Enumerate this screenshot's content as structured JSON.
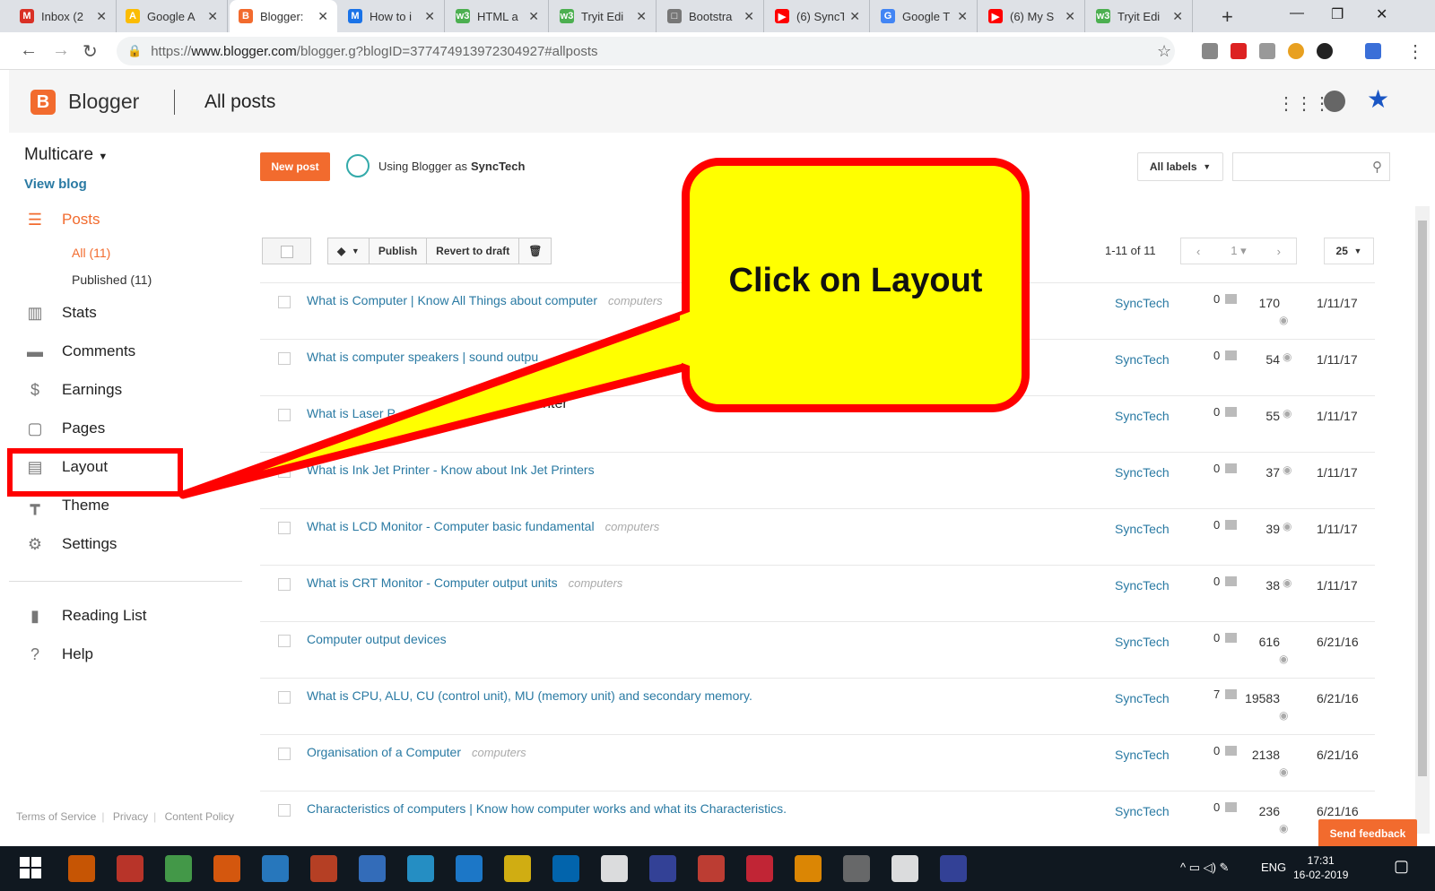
{
  "browser": {
    "tabs": [
      {
        "label": "Inbox (2",
        "icon": "gmail-icon",
        "color": "#d93025",
        "glyph": "M"
      },
      {
        "label": "Google A",
        "icon": "google-ads-icon",
        "color": "#fbbc04",
        "glyph": "A"
      },
      {
        "label": "Blogger:",
        "icon": "blogger-icon",
        "color": "#f26b2e",
        "glyph": "B"
      },
      {
        "label": "How to i",
        "icon": "site-icon",
        "color": "#1a73e8",
        "glyph": "M"
      },
      {
        "label": "HTML a",
        "icon": "w3schools-icon",
        "color": "#4caf50",
        "glyph": "w3"
      },
      {
        "label": "Tryit Edi",
        "icon": "w3schools-icon",
        "color": "#4caf50",
        "glyph": "w3"
      },
      {
        "label": "Bootstra",
        "icon": "document-icon",
        "color": "#777777",
        "glyph": "□"
      },
      {
        "label": "(6) SyncT",
        "icon": "youtube-icon",
        "color": "#ff0000",
        "glyph": "▶"
      },
      {
        "label": "Google T",
        "icon": "google-translate-icon",
        "color": "#4285f4",
        "glyph": "G"
      },
      {
        "label": "(6) My S",
        "icon": "youtube-icon",
        "color": "#ff0000",
        "glyph": "▶"
      },
      {
        "label": "Tryit Edi",
        "icon": "w3schools-icon",
        "color": "#4caf50",
        "glyph": "w3"
      }
    ],
    "url_scheme": "https://",
    "url_host": "www.blogger.com",
    "url_path": "/blogger.g?blogID=3774749139723049​27#allposts"
  },
  "header": {
    "app_name": "Blogger",
    "page_title": "All posts"
  },
  "sidebar": {
    "blog_name": "Multicare",
    "view_blog": "View blog",
    "posts": "Posts",
    "sub_all": "All (11)",
    "sub_published": "Published (11)",
    "items": [
      {
        "label": "Stats",
        "icon": "stats-icon",
        "glyph": "▥"
      },
      {
        "label": "Comments",
        "icon": "comments-icon",
        "glyph": "▬"
      },
      {
        "label": "Earnings",
        "icon": "dollar-icon",
        "glyph": "$"
      },
      {
        "label": "Pages",
        "icon": "pages-icon",
        "glyph": "▢"
      },
      {
        "label": "Layout",
        "icon": "layout-icon",
        "glyph": "▤"
      },
      {
        "label": "Theme",
        "icon": "paint-roller-icon",
        "glyph": "┳"
      },
      {
        "label": "Settings",
        "icon": "gear-icon",
        "glyph": "⚙"
      }
    ],
    "reading_list": "Reading List",
    "help": "Help",
    "footer": [
      "Terms of Service",
      "Privacy",
      "Content Policy"
    ]
  },
  "main": {
    "new_post": "New post",
    "using_as_prefix": "Using Blogger as",
    "using_as_name": "SyncTech",
    "labels_dropdown": "All labels",
    "actions": {
      "publish": "Publish",
      "revert": "Revert to draft"
    },
    "range": "1-11 of 11",
    "page": "1",
    "per_page": "25",
    "send_feedback": "Send feedback"
  },
  "posts": [
    {
      "title": "What is Computer | Know All Things about computer",
      "label": "computers",
      "author": "SyncTech",
      "comments": "0",
      "views": "170",
      "date": "1/11/17"
    },
    {
      "title": "What is computer speakers | sound outpu",
      "label": "",
      "author": "SyncTech",
      "comments": "0",
      "views": "54",
      "date": "1/11/17"
    },
    {
      "title": "What is Laser P",
      "label": "",
      "author": "SyncTech",
      "comments": "0",
      "views": "55",
      "date": "1/11/17",
      "tail": "aser Printer"
    },
    {
      "title": "What is Ink Jet Printer - Know about Ink Jet Printers",
      "label": "",
      "author": "SyncTech",
      "comments": "0",
      "views": "37",
      "date": "1/11/17"
    },
    {
      "title": "What is LCD Monitor - Computer basic fundamental",
      "label": "computers",
      "author": "SyncTech",
      "comments": "0",
      "views": "39",
      "date": "1/11/17"
    },
    {
      "title": "What is CRT Monitor - Computer output units",
      "label": "computers",
      "author": "SyncTech",
      "comments": "0",
      "views": "38",
      "date": "1/11/17"
    },
    {
      "title": "Computer output devices",
      "label": "",
      "author": "SyncTech",
      "comments": "0",
      "views": "616",
      "date": "6/21/16"
    },
    {
      "title": "What is CPU, ALU, CU (control unit), MU (memory unit) and secondary memory.",
      "label": "",
      "author": "SyncTech",
      "comments": "7",
      "views": "19583",
      "date": "6/21/16"
    },
    {
      "title": "Organisation of a Computer",
      "label": "computers",
      "author": "SyncTech",
      "comments": "0",
      "views": "2138",
      "date": "6/21/16"
    },
    {
      "title": "Characteristics of computers | Know how computer works and what its Characteristics.",
      "label": "",
      "author": "SyncTech",
      "comments": "0",
      "views": "236",
      "date": "6/21/16"
    }
  ],
  "callout": {
    "text": "Click on Layout"
  },
  "taskbar": {
    "language": "ENG",
    "time": "17:31",
    "date": "16-02-2019"
  }
}
